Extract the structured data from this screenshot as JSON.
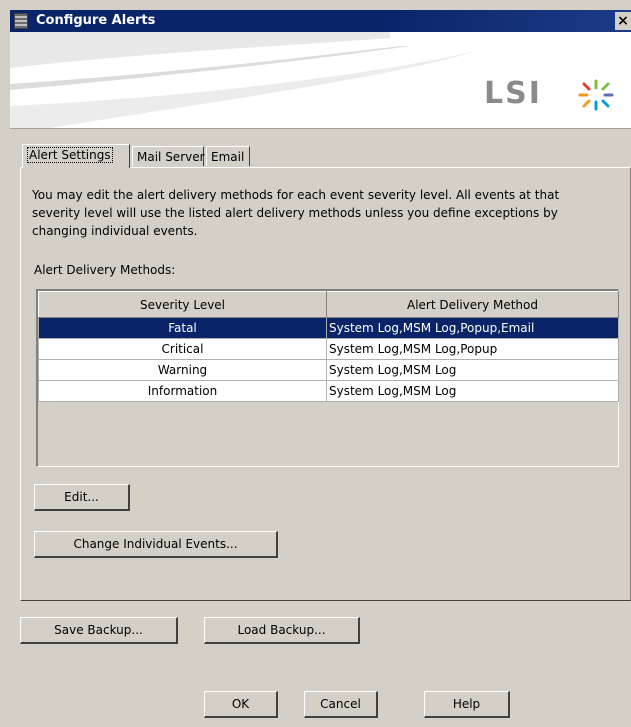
{
  "window": {
    "title": "Configure Alerts",
    "close_glyph": "×"
  },
  "banner": {
    "logo_text": "LSI"
  },
  "tabs": [
    {
      "label": "Alert Settings",
      "active": true
    },
    {
      "label": "Mail Server",
      "active": false
    },
    {
      "label": "Email",
      "active": false
    }
  ],
  "alert_settings": {
    "description": "You may edit the alert delivery methods for each event severity level. All events at that severity level will use the listed alert delivery methods unless you define exceptions by changing individual events.",
    "methods_label": "Alert Delivery Methods:",
    "columns": [
      "Severity Level",
      "Alert Delivery Method"
    ],
    "rows": [
      {
        "severity": "Fatal",
        "method": "System Log,MSM Log,Popup,Email",
        "selected": true
      },
      {
        "severity": "Critical",
        "method": "System Log,MSM Log,Popup",
        "selected": false
      },
      {
        "severity": "Warning",
        "method": "System Log,MSM Log",
        "selected": false
      },
      {
        "severity": "Information",
        "method": "System Log,MSM Log",
        "selected": false
      }
    ],
    "edit_label": "Edit...",
    "change_events_label": "Change Individual Events..."
  },
  "backup": {
    "save_label": "Save Backup...",
    "load_label": "Load Backup..."
  },
  "footer": {
    "ok_label": "OK",
    "cancel_label": "Cancel",
    "help_label": "Help"
  },
  "colors": {
    "title_bar": "#0a246a",
    "selection": "#0a246a",
    "dialog_face": "#d4d0c8"
  }
}
